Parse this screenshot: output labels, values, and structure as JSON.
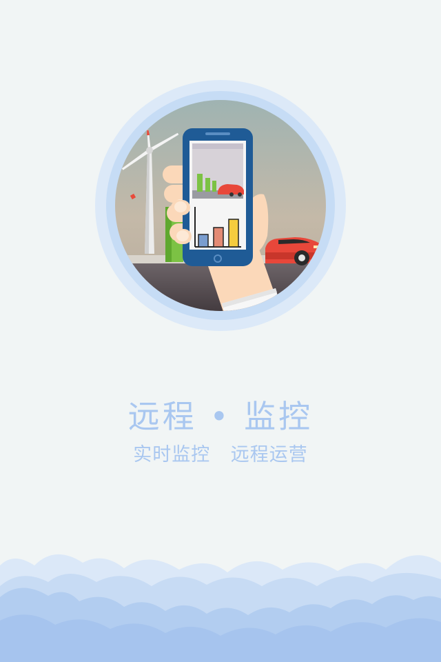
{
  "splash": {
    "title": "远程 • 监控",
    "subtitle": "实时监控   远程运营"
  },
  "illustration": {
    "icons": [
      "wind-turbine-icon",
      "charging-station-icon",
      "smartphone-icon",
      "bar-chart-icon",
      "car-icon",
      "hand-icon"
    ]
  },
  "colors": {
    "background": "#f1f5f5",
    "text_accent": "#a9c7f0",
    "phone_body": "#1f5b96",
    "car": "#e8473a",
    "charger": "#7cc244",
    "cloud_front": "#a8c6ef",
    "cloud_back": "#cfe0f5"
  }
}
